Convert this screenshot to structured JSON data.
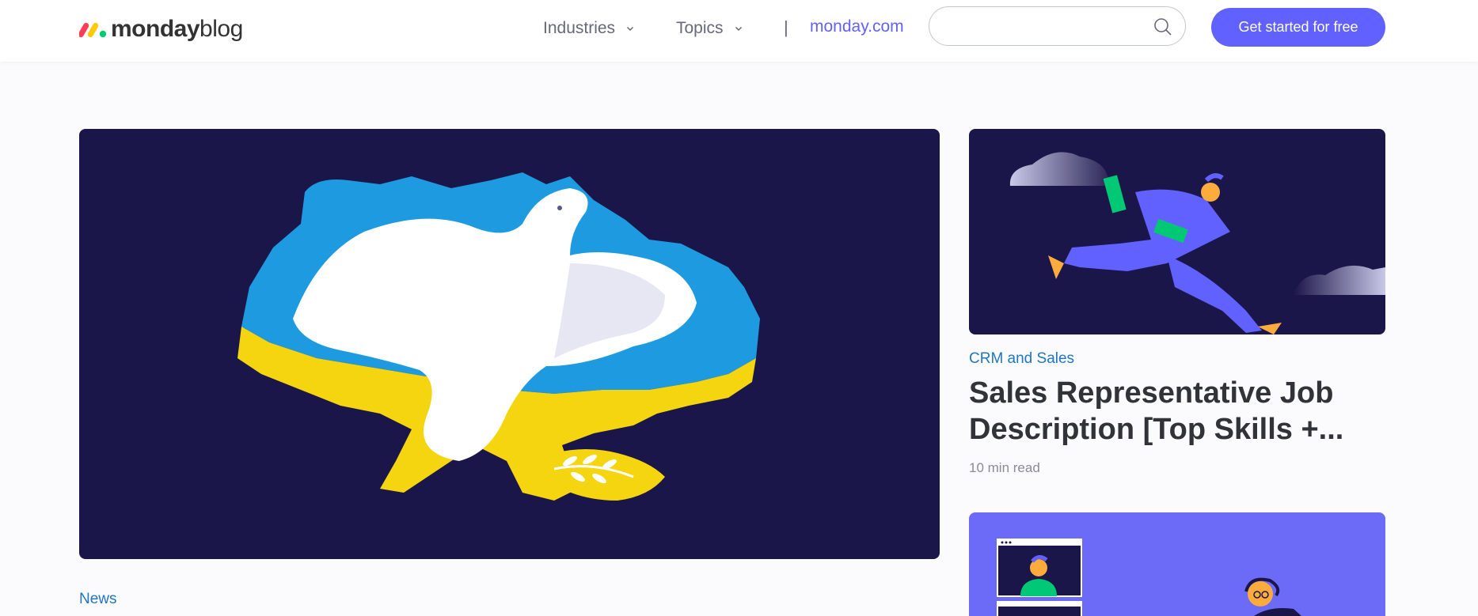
{
  "header": {
    "logo_brand": "monday",
    "logo_suffix": "blog",
    "nav": {
      "industries_label": "Industries",
      "topics_label": "Topics",
      "divider": "|",
      "external_link": "monday.com"
    },
    "search": {
      "value": "",
      "placeholder": ""
    },
    "cta_label": "Get started for free"
  },
  "hero": {
    "category": "News",
    "image_icon": "ukraine-dove-illustration"
  },
  "side_cards": [
    {
      "category": "CRM and Sales",
      "title": "Sales Representative Job Description [Top Skills +...",
      "meta": "10 min read",
      "image_icon": "running-person-illustration"
    },
    {
      "image_icon": "video-call-illustration"
    }
  ],
  "colors": {
    "accent": "#6161ff",
    "category_link": "#1f76c2",
    "hero_bg": "#1b1649",
    "flag_blue": "#1e9be0",
    "flag_yellow": "#f5d510"
  }
}
